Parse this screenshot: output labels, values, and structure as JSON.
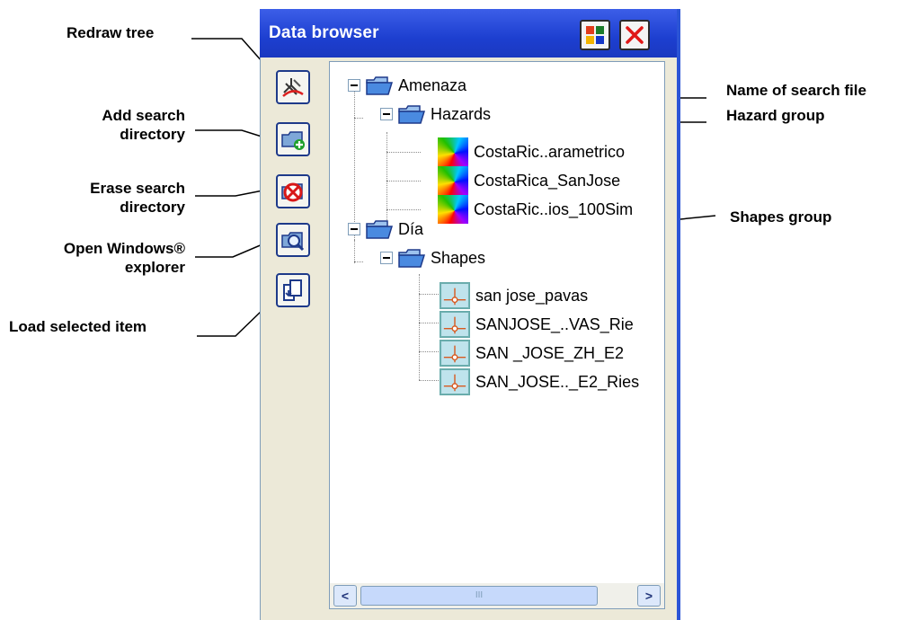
{
  "panel": {
    "title": "Data browser",
    "layout_icon": "layout-icon",
    "close_icon": "close-icon"
  },
  "toolbar": [
    {
      "name": "redraw-tree-button",
      "icon": "redraw-tree-icon"
    },
    {
      "name": "add-search-directory-button",
      "icon": "add-folder-icon"
    },
    {
      "name": "erase-search-directory-button",
      "icon": "erase-folder-icon"
    },
    {
      "name": "open-explorer-button",
      "icon": "explore-folder-icon"
    },
    {
      "name": "load-selected-item-button",
      "icon": "load-item-icon"
    }
  ],
  "tree": {
    "root1": {
      "label": "Amenaza"
    },
    "hazards": {
      "label": "Hazards"
    },
    "hazard_items": [
      "CostaRic..arametrico",
      "CostaRica_SanJose",
      "CostaRic..ios_100Sim"
    ],
    "root2": {
      "label": "Día"
    },
    "shapes": {
      "label": "Shapes"
    },
    "shape_items": [
      "san jose_pavas",
      "SANJOSE_..VAS_Rie",
      "SAN _JOSE_ZH_E2",
      "SAN_JOSE.._E2_Ries"
    ]
  },
  "scrollbar": {
    "left": "<",
    "right": ">",
    "thumb": "III"
  },
  "callouts": {
    "redraw_tree": "Redraw tree",
    "add_search_1": "Add search",
    "add_search_2": "directory",
    "erase_search_1": "Erase search",
    "erase_search_2": "directory",
    "open_windows_1": "Open Windows®",
    "open_windows_2": "explorer",
    "load_selected": "Load selected item",
    "name_of_search_file": "Name of search file",
    "hazard_group": "Hazard group",
    "shapes_group": "Shapes group"
  }
}
